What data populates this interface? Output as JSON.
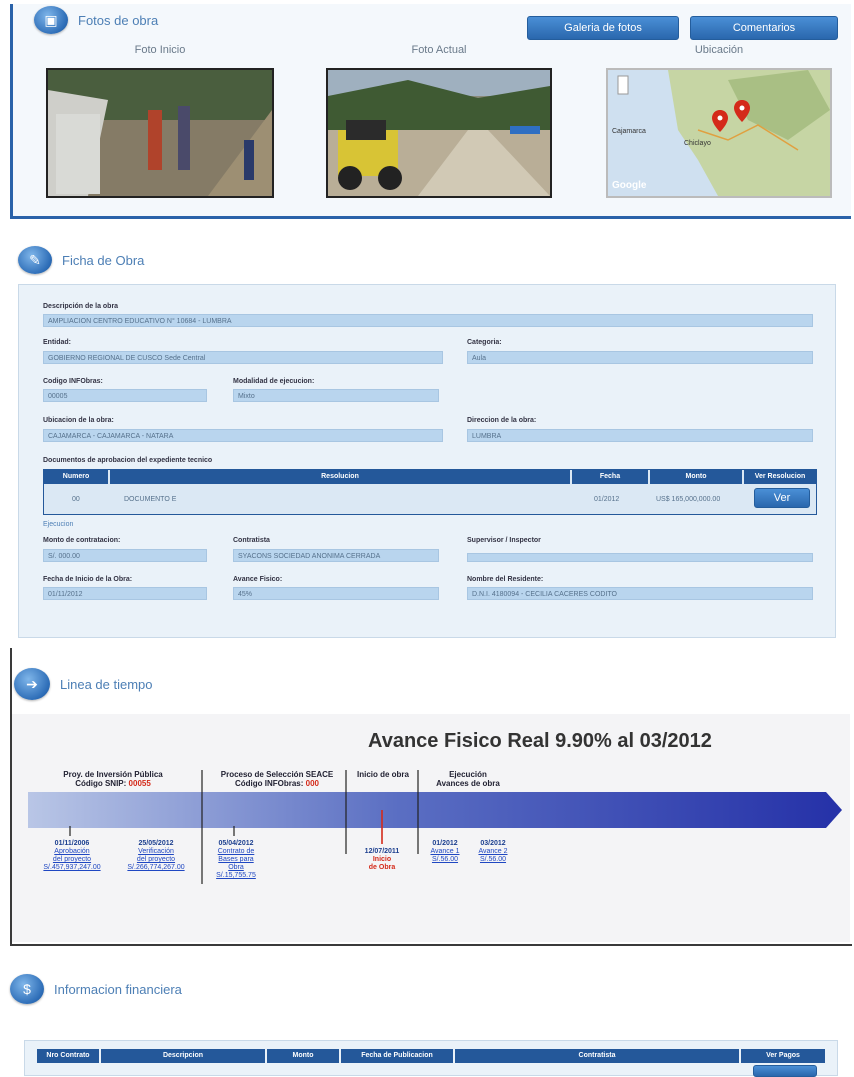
{
  "photos": {
    "title": "Fotos de obra",
    "gallery_button": "Galeria de fotos",
    "comments_button": "Comentarios",
    "label_start": "Foto Inicio",
    "label_current": "Foto Actual",
    "label_location": "Ubicación",
    "map_places": [
      "Cajamarca",
      "Chiclayo"
    ],
    "map_brand": "Google"
  },
  "ficha": {
    "title": "Ficha de Obra",
    "descripcion_label": "Descripción de la obra",
    "descripcion_value": "AMPLIACION CENTRO EDUCATIVO N° 10684 - LUMBRA",
    "entidad_label": "Entidad:",
    "entidad_value": "GOBIERNO REGIONAL DE CUSCO Sede Central",
    "categoria_label": "Categoria:",
    "categoria_value": "Aula",
    "codigo_label": "Codigo INFObras:",
    "codigo_value": "00005",
    "modalidad_label": "Modalidad de ejecucion:",
    "modalidad_value": "Mixto",
    "ubicacion_label": "Ubicacion de la obra:",
    "ubicacion_value": "CAJAMARCA - CAJAMARCA - NATARA",
    "direccion_label": "Direccion de la obra:",
    "direccion_value": "LUMBRA",
    "documentos_label": "Documentos de aprobacion del expediente tecnico",
    "doc_table": {
      "headers": [
        "Numero",
        "Resolucion",
        "Fecha",
        "Monto",
        "Ver Resolucion"
      ],
      "row": {
        "numero": "00",
        "resolucion": "DOCUMENTO E",
        "fecha": "01/2012",
        "monto": "US$ 165,000,000.00",
        "ver": "Ver"
      }
    },
    "ejecucion_label": "Ejecucion",
    "monto_label": "Monto de contratacion:",
    "monto_value": "S/. 000.00",
    "contratista_label": "Contratista",
    "contratista_value": "SYACONS SOCIEDAD ANONIMA CERRADA",
    "supervisor_label": "Supervisor / Inspector",
    "supervisor_value": "",
    "fecha_inicio_label": "Fecha de Inicio de la Obra:",
    "fecha_inicio_value": "01/11/2012",
    "avance_label": "Avance Fisico:",
    "avance_value": "45%",
    "residente_label": "Nombre del Residente:",
    "residente_value": "D.N.I. 4180094 - CECILIA CACERES CODITO"
  },
  "timeline": {
    "title": "Linea de tiempo",
    "headline": "Avance Fisico Real 9.90% al 03/2012",
    "phases": [
      {
        "label": "Proy. de Inversión Pública",
        "sub": "Código SNIP:",
        "code": "00055"
      },
      {
        "label": "Proceso de Selección SEACE",
        "sub": "Código INFObras:",
        "code": "000"
      },
      {
        "label": "Inicio de obra",
        "sub": "",
        "code": ""
      },
      {
        "label": "Ejecución",
        "sub": "Avances de obra",
        "code": ""
      }
    ],
    "events": [
      {
        "date": "01/11/2006",
        "line1": "Aprobación",
        "line2": "del proyecto",
        "line3": "S/.457,937,247.00"
      },
      {
        "date": "25/05/2012",
        "line1": "Verificación",
        "line2": "del proyecto",
        "line3": "S/.266,774,267.00"
      },
      {
        "date": "05/04/2012",
        "line1": "Contrato de",
        "line2": "Bases para",
        "line3": "Obra",
        "line4": "S/.15,755.75"
      },
      {
        "date": "12/07/2011",
        "line1": "Inicio",
        "line2": "de Obra"
      },
      {
        "date": "01/2012",
        "line1": "Avance 1",
        "line2": "S/.56.00"
      },
      {
        "date": "03/2012",
        "line1": "Avance 2",
        "line2": "S/.56.00"
      }
    ]
  },
  "finance": {
    "title": "Informacion financiera",
    "headers": [
      "Nro Contrato",
      "Descripcion",
      "Monto",
      "Fecha de Publicacion",
      "Contratista",
      "Ver Pagos"
    ]
  }
}
